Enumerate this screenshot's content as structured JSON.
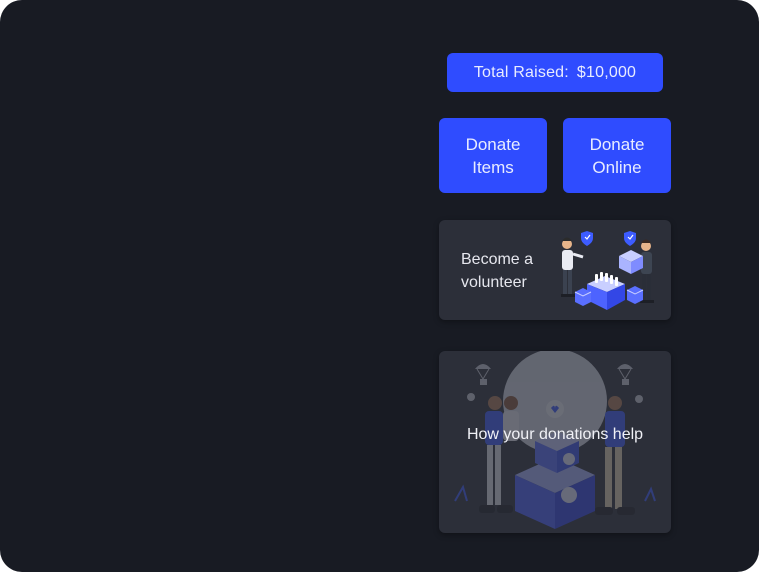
{
  "summary": {
    "total_label": "Total Raised:",
    "total_value": "$10,000"
  },
  "actions": {
    "donate_items": [
      "Donate",
      "Items"
    ],
    "donate_online": [
      "Donate",
      "Online"
    ]
  },
  "cards": {
    "volunteer": [
      "Become a",
      "volunteer"
    ],
    "help": "How your donations help"
  },
  "illustrations": {
    "volunteer": "volunteers-packing-boxes-illustration",
    "help": "volunteers-with-donation-boxes-illustration"
  },
  "colors": {
    "background": "#181b23",
    "accent": "#2f4cff",
    "card": "#2c2f39",
    "text": "#e8ecff"
  }
}
